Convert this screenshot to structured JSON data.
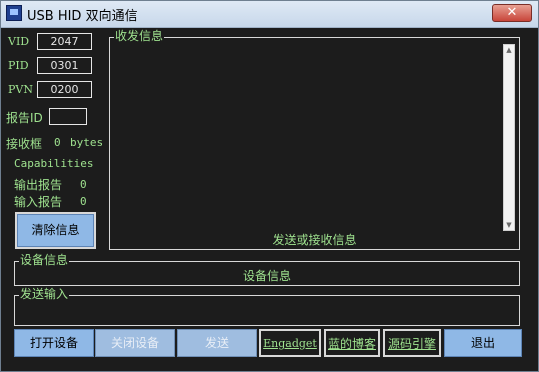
{
  "window": {
    "title": "USB HID 双向通信",
    "close_glyph": "✕"
  },
  "device_fields": {
    "vid_label": "VID",
    "vid_value": "2047",
    "pid_label": "PID",
    "pid_value": "0301",
    "pvn_label": "PVN",
    "pvn_value": "0200",
    "report_id_label": "报告ID",
    "report_id_value": ""
  },
  "receive_box": {
    "label": "接收框",
    "count": "0",
    "unit": "bytes"
  },
  "capabilities": {
    "title": "Capabilities",
    "output_label": "输出报告",
    "output_value": "0",
    "input_label": "输入报告",
    "input_value": "0"
  },
  "clear_button": {
    "label": "清除信息"
  },
  "messages_group": {
    "legend": "收发信息",
    "content": "发送或接收信息"
  },
  "device_info_group": {
    "legend": "设备信息",
    "content": "设备信息"
  },
  "send_input_group": {
    "legend": "发送输入",
    "value": ""
  },
  "bottom_buttons": {
    "open": "打开设备",
    "close": "关闭设备",
    "send": "发送",
    "engadget": "Engadget",
    "blog": "蓝的博客",
    "source": "源码引擎",
    "exit": "退出"
  },
  "colors": {
    "background": "#1c1c1c",
    "label_green": "#9fe28f",
    "button_blue": "#8fb8e6"
  },
  "icons": {
    "app": "app-window-icon",
    "close": "close-icon",
    "scroll_up": "scroll-up-arrow-icon",
    "scroll_down": "scroll-down-arrow-icon"
  }
}
